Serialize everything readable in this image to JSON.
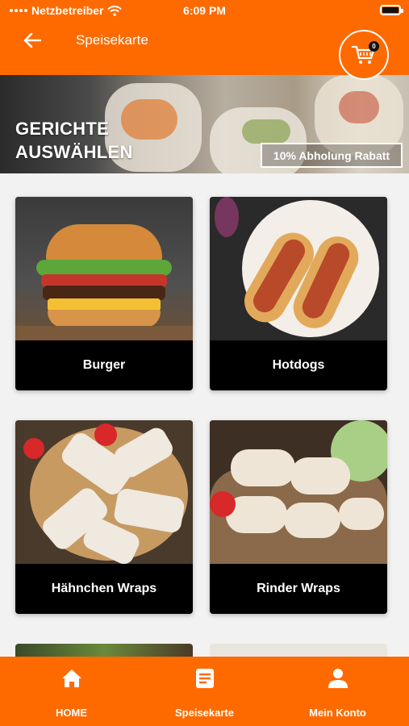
{
  "status_bar": {
    "carrier": "Netzbetreiber",
    "time": "6:09 PM"
  },
  "app_bar": {
    "title": "Speisekarte",
    "cart_count": "0"
  },
  "hero": {
    "title_line1": "GERICHTE",
    "title_line2": "AUSWÄHLEN",
    "badge": "10% Abholung Rabatt"
  },
  "categories": [
    {
      "label": "Burger"
    },
    {
      "label": "Hotdogs"
    },
    {
      "label": "Hähnchen Wraps"
    },
    {
      "label": "Rinder Wraps"
    }
  ],
  "bottom_nav": {
    "items": [
      {
        "label": "HOME",
        "icon": "home-icon"
      },
      {
        "label": "Speisekarte",
        "icon": "menu-list-icon"
      },
      {
        "label": "Mein Konto",
        "icon": "person-icon"
      }
    ]
  },
  "colors": {
    "accent": "#ff6a00",
    "card_label_bg": "#000000"
  }
}
